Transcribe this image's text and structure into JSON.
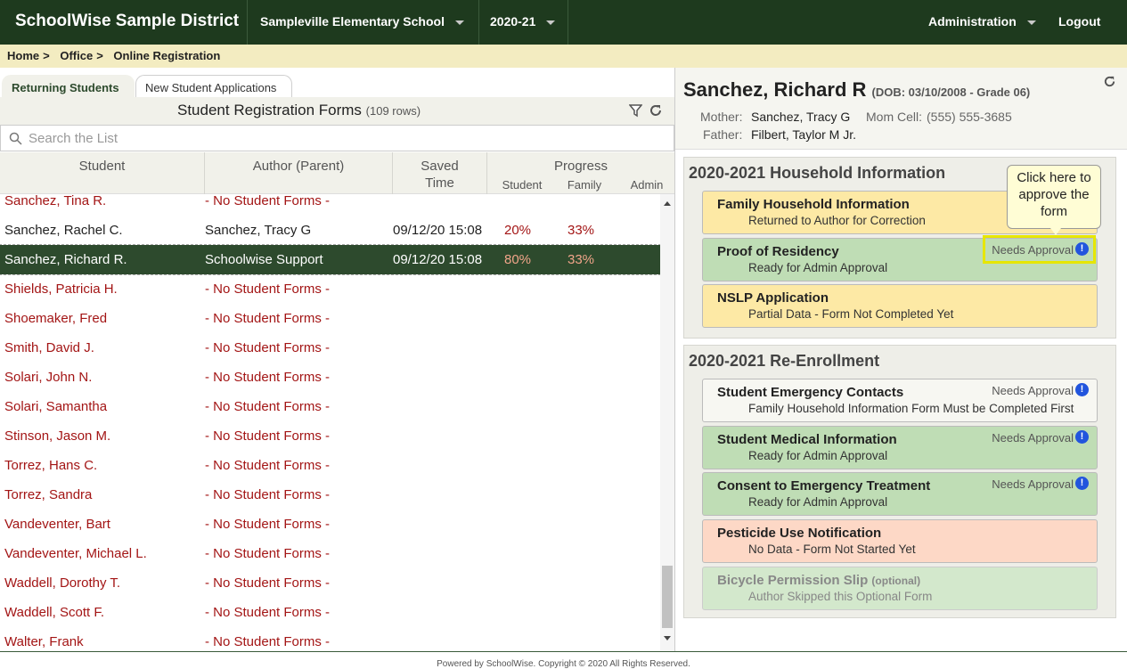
{
  "topbar": {
    "brand": "SchoolWise Sample District",
    "school": "Sampleville Elementary School",
    "year": "2020-21",
    "admin": "Administration",
    "logout": "Logout"
  },
  "breadcrumb": [
    "Home",
    ">",
    "Office",
    ">",
    "Online Registration"
  ],
  "tabs": [
    "Returning Students",
    "New Student Applications"
  ],
  "list": {
    "title": "Student Registration Forms",
    "count": "(109 rows)",
    "search_placeholder": "Search the List",
    "headers": {
      "student": "Student",
      "author": "Author (Parent)",
      "saved1": "Saved",
      "saved2": "Time",
      "progress": "Progress",
      "p_student": "Student",
      "p_family": "Family",
      "p_admin": "Admin"
    },
    "rows": [
      {
        "student": "Sanchez, Tina R.",
        "author": "- No Student Forms -",
        "time": "",
        "sp": "",
        "fp": ""
      },
      {
        "student": "Sanchez, Rachel C.",
        "author": "Sanchez, Tracy G",
        "time": "09/12/20 15:08",
        "sp": "20%",
        "fp": "33%"
      },
      {
        "student": "Sanchez, Richard R.",
        "author": "Schoolwise Support",
        "time": "09/12/20 15:08",
        "sp": "80%",
        "fp": "33%"
      },
      {
        "student": "Shields, Patricia H.",
        "author": "- No Student Forms -",
        "time": "",
        "sp": "",
        "fp": ""
      },
      {
        "student": "Shoemaker, Fred",
        "author": "- No Student Forms -",
        "time": "",
        "sp": "",
        "fp": ""
      },
      {
        "student": "Smith, David J.",
        "author": "- No Student Forms -",
        "time": "",
        "sp": "",
        "fp": ""
      },
      {
        "student": "Solari, John N.",
        "author": "- No Student Forms -",
        "time": "",
        "sp": "",
        "fp": ""
      },
      {
        "student": "Solari, Samantha",
        "author": "- No Student Forms -",
        "time": "",
        "sp": "",
        "fp": ""
      },
      {
        "student": "Stinson, Jason M.",
        "author": "- No Student Forms -",
        "time": "",
        "sp": "",
        "fp": ""
      },
      {
        "student": "Torrez, Hans C.",
        "author": "- No Student Forms -",
        "time": "",
        "sp": "",
        "fp": ""
      },
      {
        "student": "Torrez, Sandra",
        "author": "- No Student Forms -",
        "time": "",
        "sp": "",
        "fp": ""
      },
      {
        "student": "Vandeventer, Bart",
        "author": "- No Student Forms -",
        "time": "",
        "sp": "",
        "fp": ""
      },
      {
        "student": "Vandeventer, Michael L.",
        "author": "- No Student Forms -",
        "time": "",
        "sp": "",
        "fp": ""
      },
      {
        "student": "Waddell, Dorothy T.",
        "author": "- No Student Forms -",
        "time": "",
        "sp": "",
        "fp": ""
      },
      {
        "student": "Waddell, Scott F.",
        "author": "- No Student Forms -",
        "time": "",
        "sp": "",
        "fp": ""
      },
      {
        "student": "Walter, Frank",
        "author": "- No Student Forms -",
        "time": "",
        "sp": "",
        "fp": ""
      }
    ]
  },
  "detail": {
    "name": "Sanchez, Richard R",
    "dob": "(DOB: 03/10/2008 - Grade 06)",
    "mother_label": "Mother:",
    "mother": "Sanchez, Tracy G",
    "mom_cell_label": "Mom Cell:",
    "mom_cell": "(555) 555-3685",
    "father_label": "Father:",
    "father": "Filbert, Taylor M Jr.",
    "household": {
      "title": "2020-2021 Household Information",
      "cards": [
        {
          "title": "Family Household Information",
          "status": "Returned to Author for Correction",
          "badge": ""
        },
        {
          "title": "Proof of Residency",
          "status": "Ready for Admin Approval",
          "badge": "Needs Approval"
        },
        {
          "title": "NSLP Application",
          "status": "Partial Data - Form Not Completed Yet",
          "badge": ""
        }
      ]
    },
    "reenroll": {
      "title": "2020-2021 Re-Enrollment",
      "cards": [
        {
          "title": "Student Emergency Contacts",
          "status": "Family Household Information Form Must be Completed First",
          "badge": "Needs Approval"
        },
        {
          "title": "Student Medical Information",
          "status": "Ready for Admin Approval",
          "badge": "Needs Approval"
        },
        {
          "title": "Consent to Emergency Treatment",
          "status": "Ready for Admin Approval",
          "badge": "Needs Approval"
        },
        {
          "title": "Pesticide Use Notification",
          "status": "No Data - Form Not Started Yet",
          "badge": ""
        },
        {
          "title": "Bicycle Permission Slip",
          "optional": "(optional)",
          "status": "Author Skipped this Optional Form",
          "badge": ""
        }
      ]
    },
    "tooltip": "Click here to approve the form",
    "bang": "!"
  },
  "footer": "Powered by SchoolWise. Copyright © 2020 All Rights Reserved.",
  "colors": {
    "brand_green": "#1e3a1e",
    "selected_row": "#2d4a2d",
    "red_text": "#a31515",
    "yellow_card": "#fde9a5",
    "green_card": "#bfddb5",
    "pink_card": "#fdd8c6"
  }
}
